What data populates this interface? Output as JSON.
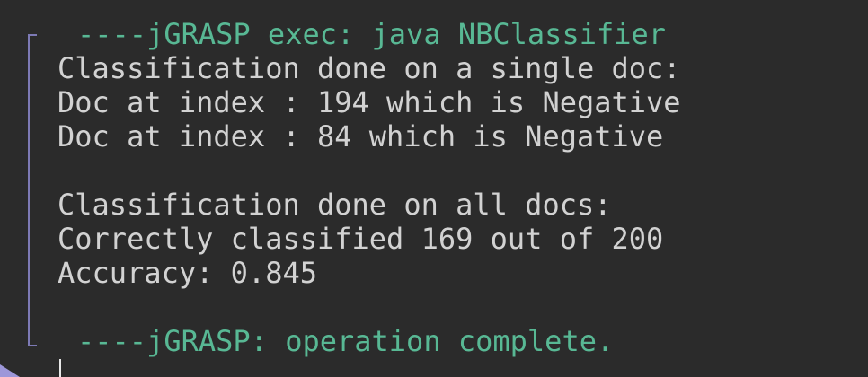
{
  "console": {
    "exec_header": "----jGRASP exec: java NBClassifier",
    "lines": [
      "Classification done on a single doc:",
      "Doc at index : 194 which is Negative",
      "Doc at index : 84 which is Negative",
      "",
      "Classification done on all docs:",
      "Correctly classified 169 out of 200",
      "Accuracy: 0.845",
      ""
    ],
    "footer": "----jGRASP: operation complete."
  },
  "colors": {
    "background": "#2b2b2b",
    "text": "#d2d2d2",
    "exec_text": "#58b894",
    "bracket": "#7d7ab5"
  }
}
